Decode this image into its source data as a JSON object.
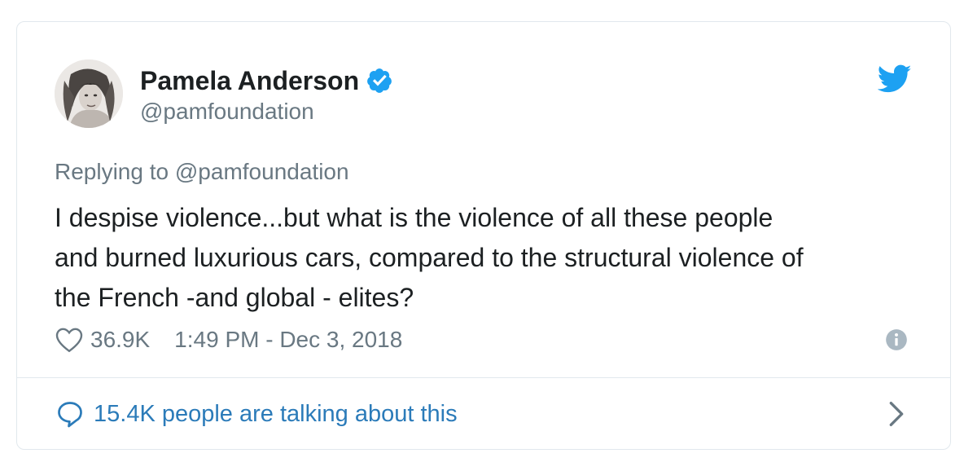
{
  "tweet": {
    "author": {
      "display_name": "Pamela Anderson",
      "handle": "@pamfoundation",
      "verified": true,
      "avatar_icon": "user-avatar-photo"
    },
    "reply_context": {
      "prefix": "Replying to",
      "mention": "@pamfoundation"
    },
    "text_lines": [
      "I despise violence...but what is the violence of all these people",
      "and burned luxurious cars, compared to the structural violence of",
      "the French -and global - elites?"
    ],
    "likes": "36.9K",
    "timestamp": "1:49 PM - Dec 3, 2018",
    "conversation": "15.4K people are talking about this"
  },
  "icons": {
    "verified": "verified-badge-icon",
    "brand": "twitter-bird-icon",
    "like": "heart-icon",
    "info": "info-icon",
    "conversation": "speech-bubble-icon",
    "more": "chevron-right-icon"
  },
  "colors": {
    "twitter_blue": "#1da1f2",
    "link_blue": "#2b7bb9",
    "muted_text": "#697882",
    "body_text": "#1c2022",
    "border": "#e1e8ed",
    "icon_gray": "#aab8c2"
  }
}
